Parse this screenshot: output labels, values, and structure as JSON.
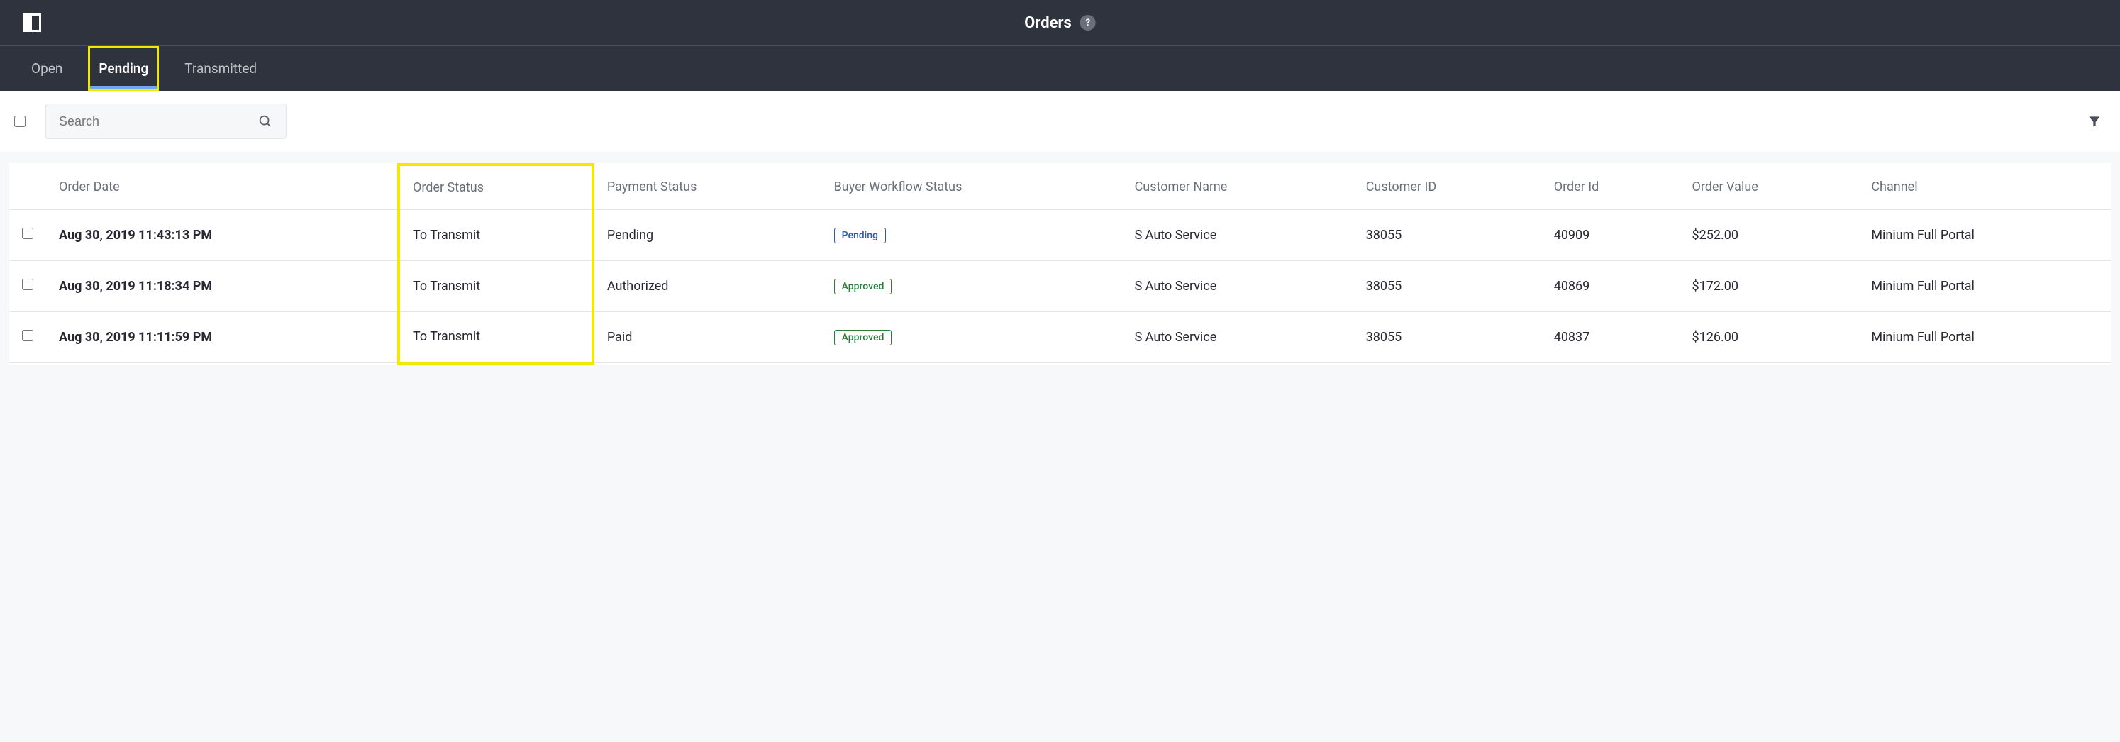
{
  "header": {
    "title": "Orders",
    "help_symbol": "?"
  },
  "tabs": [
    {
      "label": "Open",
      "active": false
    },
    {
      "label": "Pending",
      "active": true
    },
    {
      "label": "Transmitted",
      "active": false
    }
  ],
  "toolbar": {
    "search_placeholder": "Search"
  },
  "table": {
    "columns": {
      "order_date": "Order Date",
      "order_status": "Order Status",
      "payment_status": "Payment Status",
      "buyer_workflow_status": "Buyer Workflow Status",
      "customer_name": "Customer Name",
      "customer_id": "Customer ID",
      "order_id": "Order Id",
      "order_value": "Order Value",
      "channel": "Channel"
    },
    "rows": [
      {
        "order_date": "Aug 30, 2019 11:43:13 PM",
        "order_status": "To Transmit",
        "payment_status": "Pending",
        "buyer_workflow_status": "Pending",
        "buyer_workflow_kind": "pending",
        "customer_name": "S Auto Service",
        "customer_id": "38055",
        "order_id": "40909",
        "order_value": "$252.00",
        "channel": "Minium Full Portal"
      },
      {
        "order_date": "Aug 30, 2019 11:18:34 PM",
        "order_status": "To Transmit",
        "payment_status": "Authorized",
        "buyer_workflow_status": "Approved",
        "buyer_workflow_kind": "approved",
        "customer_name": "S Auto Service",
        "customer_id": "38055",
        "order_id": "40869",
        "order_value": "$172.00",
        "channel": "Minium Full Portal"
      },
      {
        "order_date": "Aug 30, 2019 11:11:59 PM",
        "order_status": "To Transmit",
        "payment_status": "Paid",
        "buyer_workflow_status": "Approved",
        "buyer_workflow_kind": "approved",
        "customer_name": "S Auto Service",
        "customer_id": "38055",
        "order_id": "40837",
        "order_value": "$126.00",
        "channel": "Minium Full Portal"
      }
    ]
  },
  "highlights": {
    "active_tab_box": true,
    "order_status_column_box": true
  }
}
